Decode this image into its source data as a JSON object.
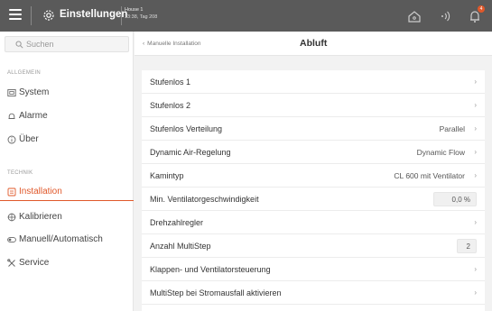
{
  "header": {
    "app_title": "Einstellungen",
    "house_name": "House 1",
    "house_time": "13:38, Tag 208",
    "notification_count": "4"
  },
  "sidebar": {
    "search_placeholder": "Suchen",
    "sections": [
      {
        "label": "ALLGEMEIN",
        "items": [
          {
            "label": "System",
            "icon": "system-icon"
          },
          {
            "label": "Alarme",
            "icon": "bell-icon"
          },
          {
            "label": "Über",
            "icon": "info-icon"
          }
        ]
      },
      {
        "label": "TECHNIK",
        "items": [
          {
            "label": "Installation",
            "icon": "installation-icon",
            "active": true
          },
          {
            "label": "Kalibrieren",
            "icon": "calibrate-icon"
          },
          {
            "label": "Manuell/Automatisch",
            "icon": "toggle-icon"
          },
          {
            "label": "Service",
            "icon": "tools-icon"
          }
        ]
      }
    ]
  },
  "main": {
    "back_label": "Manuelle Installation",
    "title": "Abluft",
    "rows": [
      {
        "label": "Stufenlos 1",
        "value": "",
        "type": "nav"
      },
      {
        "label": "Stufenlos 2",
        "value": "",
        "type": "nav"
      },
      {
        "label": "Stufenlos Verteilung",
        "value": "Parallel",
        "type": "nav"
      },
      {
        "label": "Dynamic Air-Regelung",
        "value": "Dynamic Flow",
        "type": "nav"
      },
      {
        "label": "Kamintyp",
        "value": "CL 600 mit Ventilator",
        "type": "nav"
      },
      {
        "label": "Min. Ventilatorgeschwindigkeit",
        "value": "0,0 %",
        "type": "input"
      },
      {
        "label": "Drehzahlregler",
        "value": "",
        "type": "nav"
      },
      {
        "label": "Anzahl MultiStep",
        "value": "2",
        "type": "input"
      },
      {
        "label": "Klappen- und Ventilatorsteuerung",
        "value": "",
        "type": "nav"
      },
      {
        "label": "MultiStep bei Stromausfall aktivieren",
        "value": "",
        "type": "nav"
      }
    ]
  },
  "colors": {
    "accent": "#e0582a",
    "topbar": "#5a5a5a"
  }
}
